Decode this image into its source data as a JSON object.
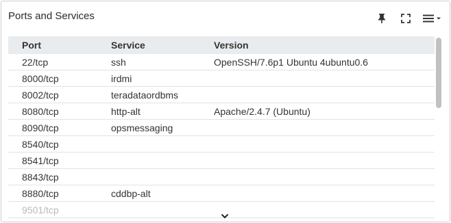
{
  "panel": {
    "title": "Ports and Services",
    "icons": [
      "pin-icon",
      "fullscreen-icon",
      "menu-icon",
      "chevron-down-icon"
    ]
  },
  "table": {
    "headers": [
      "Port",
      "Service",
      "Version"
    ],
    "rows": [
      [
        "22/tcp",
        "ssh",
        "OpenSSH/7.6p1 Ubuntu 4ubuntu0.6"
      ],
      [
        "8000/tcp",
        "irdmi",
        ""
      ],
      [
        "8002/tcp",
        "teradataordbms",
        ""
      ],
      [
        "8080/tcp",
        "http-alt",
        "Apache/2.4.7 (Ubuntu)"
      ],
      [
        "8090/tcp",
        "opsmessaging",
        ""
      ],
      [
        "8540/tcp",
        "",
        ""
      ],
      [
        "8541/tcp",
        "",
        ""
      ],
      [
        "8843/tcp",
        "",
        ""
      ],
      [
        "8880/tcp",
        "cddbp-alt",
        ""
      ],
      [
        "9501/tcp",
        "",
        ""
      ]
    ]
  },
  "colors": {
    "header_bg": "#e9ecef",
    "row_divider": "#e2e2e2",
    "faded_text": "#b8b8b8"
  }
}
